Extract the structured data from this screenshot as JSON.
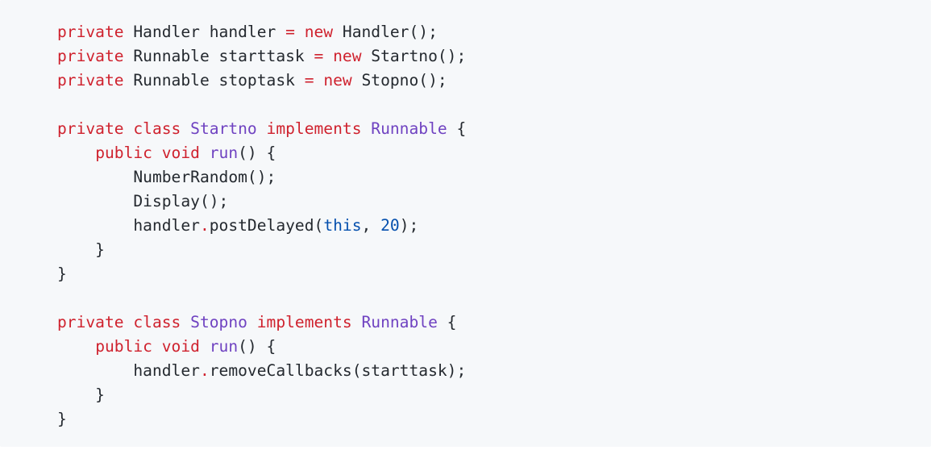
{
  "colors": {
    "background": "#f6f8fa",
    "keyword": "#cf222e",
    "type": "#6f42c1",
    "number": "#0550ae",
    "plain": "#24292f"
  },
  "code": {
    "language": "java",
    "lines": [
      [
        {
          "t": "private",
          "k": "kw"
        },
        {
          "t": " Handler handler ",
          "k": "plain"
        },
        {
          "t": "=",
          "k": "kw"
        },
        {
          "t": " ",
          "k": "plain"
        },
        {
          "t": "new",
          "k": "kw"
        },
        {
          "t": " Handler();",
          "k": "plain"
        }
      ],
      [
        {
          "t": "private",
          "k": "kw"
        },
        {
          "t": " Runnable starttask ",
          "k": "plain"
        },
        {
          "t": "=",
          "k": "kw"
        },
        {
          "t": " ",
          "k": "plain"
        },
        {
          "t": "new",
          "k": "kw"
        },
        {
          "t": " Startno();",
          "k": "plain"
        }
      ],
      [
        {
          "t": "private",
          "k": "kw"
        },
        {
          "t": " Runnable stoptask ",
          "k": "plain"
        },
        {
          "t": "=",
          "k": "kw"
        },
        {
          "t": " ",
          "k": "plain"
        },
        {
          "t": "new",
          "k": "kw"
        },
        {
          "t": " Stopno();",
          "k": "plain"
        }
      ],
      [],
      [
        {
          "t": "private",
          "k": "kw"
        },
        {
          "t": " ",
          "k": "plain"
        },
        {
          "t": "class",
          "k": "kw"
        },
        {
          "t": " ",
          "k": "plain"
        },
        {
          "t": "Startno",
          "k": "type"
        },
        {
          "t": " ",
          "k": "plain"
        },
        {
          "t": "implements",
          "k": "kw"
        },
        {
          "t": " ",
          "k": "plain"
        },
        {
          "t": "Runnable",
          "k": "type"
        },
        {
          "t": " {",
          "k": "plain"
        }
      ],
      [
        {
          "t": "    ",
          "k": "plain"
        },
        {
          "t": "public",
          "k": "kw"
        },
        {
          "t": " ",
          "k": "plain"
        },
        {
          "t": "void",
          "k": "kw"
        },
        {
          "t": " ",
          "k": "plain"
        },
        {
          "t": "run",
          "k": "fn"
        },
        {
          "t": "() {",
          "k": "plain"
        }
      ],
      [
        {
          "t": "        NumberRandom();",
          "k": "plain"
        }
      ],
      [
        {
          "t": "        Display();",
          "k": "plain"
        }
      ],
      [
        {
          "t": "        handler",
          "k": "plain"
        },
        {
          "t": ".",
          "k": "kw"
        },
        {
          "t": "postDelayed(",
          "k": "plain"
        },
        {
          "t": "this",
          "k": "this"
        },
        {
          "t": ", ",
          "k": "plain"
        },
        {
          "t": "20",
          "k": "num"
        },
        {
          "t": ");",
          "k": "plain"
        }
      ],
      [
        {
          "t": "    }",
          "k": "plain"
        }
      ],
      [
        {
          "t": "}",
          "k": "plain"
        }
      ],
      [],
      [
        {
          "t": "private",
          "k": "kw"
        },
        {
          "t": " ",
          "k": "plain"
        },
        {
          "t": "class",
          "k": "kw"
        },
        {
          "t": " ",
          "k": "plain"
        },
        {
          "t": "Stopno",
          "k": "type"
        },
        {
          "t": " ",
          "k": "plain"
        },
        {
          "t": "implements",
          "k": "kw"
        },
        {
          "t": " ",
          "k": "plain"
        },
        {
          "t": "Runnable",
          "k": "type"
        },
        {
          "t": " {",
          "k": "plain"
        }
      ],
      [
        {
          "t": "    ",
          "k": "plain"
        },
        {
          "t": "public",
          "k": "kw"
        },
        {
          "t": " ",
          "k": "plain"
        },
        {
          "t": "void",
          "k": "kw"
        },
        {
          "t": " ",
          "k": "plain"
        },
        {
          "t": "run",
          "k": "fn"
        },
        {
          "t": "() {",
          "k": "plain"
        }
      ],
      [
        {
          "t": "        handler",
          "k": "plain"
        },
        {
          "t": ".",
          "k": "kw"
        },
        {
          "t": "removeCallbacks(starttask);",
          "k": "plain"
        }
      ],
      [
        {
          "t": "    }",
          "k": "plain"
        }
      ],
      [
        {
          "t": "}",
          "k": "plain"
        }
      ]
    ]
  }
}
